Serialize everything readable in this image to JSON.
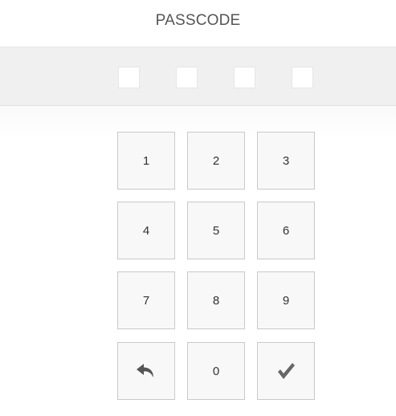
{
  "header": {
    "title": "PASSCODE"
  },
  "passcode": {
    "length": 4,
    "entered": 0
  },
  "keypad": {
    "keys": [
      "1",
      "2",
      "3",
      "4",
      "5",
      "6",
      "7",
      "8",
      "9",
      "0"
    ],
    "undo_icon": "undo-arrow-icon",
    "confirm_icon": "checkmark-icon"
  },
  "colors": {
    "bar_background": "#f0f0f0",
    "key_background": "#f8f8f8",
    "key_border": "#c9c9c9",
    "icon_color": "#555555"
  }
}
